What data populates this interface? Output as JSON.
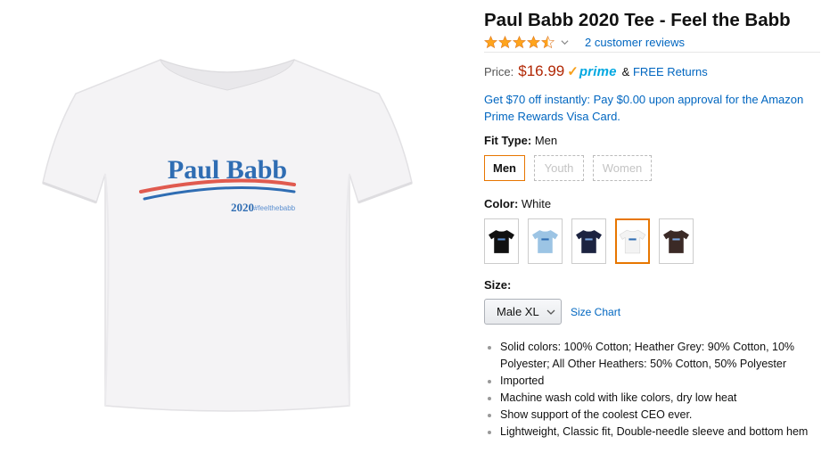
{
  "product": {
    "title": "Paul Babb 2020 Tee - Feel the Babb",
    "rating": 4.5,
    "reviews_link": "2 customer reviews",
    "image": {
      "shirt_color": "#f4f3f5",
      "logo_name": "Paul Babb",
      "logo_year": "2020",
      "logo_hashtag": "#feelthebabb",
      "logo_blue": "#2f6db3",
      "logo_red": "#e05a4f"
    }
  },
  "price": {
    "label": "Price:",
    "value": "$16.99",
    "prime": "prime",
    "returns_amp": "&",
    "returns_link": "FREE Returns"
  },
  "promo": "Get $70 off instantly: Pay $0.00 upon approval for the Amazon Prime Rewards Visa Card.",
  "fit": {
    "label": "Fit Type:",
    "selected": "Men",
    "options": [
      "Men",
      "Youth",
      "Women"
    ]
  },
  "color": {
    "label": "Color:",
    "selected": "White",
    "swatches": [
      "#111111",
      "#9cc4e4",
      "#1c2340",
      "#f3f3f3",
      "#3b2a26"
    ]
  },
  "size": {
    "label": "Size:",
    "selected": "Male XL",
    "chart_link": "Size Chart"
  },
  "bullets": [
    "Solid colors: 100% Cotton; Heather Grey: 90% Cotton, 10% Polyester; All Other Heathers: 50% Cotton, 50% Polyester",
    "Imported",
    "Machine wash cold with like colors, dry low heat",
    "Show support of the coolest CEO ever.",
    "Lightweight, Classic fit, Double-needle sleeve and bottom hem"
  ],
  "colors": {
    "accent_orange": "#e77600",
    "price_red": "#b12704",
    "link_blue": "#0066c0",
    "star_gold": "#ffa41c"
  }
}
